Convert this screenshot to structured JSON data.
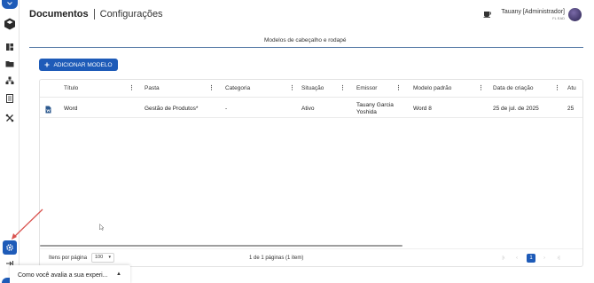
{
  "header": {
    "title": "Documentos",
    "subtitle": "Configurações"
  },
  "user": {
    "name": "Tauany [Administrador]",
    "org": "FL EAD"
  },
  "tab": {
    "label": "Modelos de cabeçalho e rodapé"
  },
  "toolbar": {
    "add_label": "ADICIONAR MODELO"
  },
  "table": {
    "columns": [
      "Título",
      "Pasta",
      "Categoria",
      "Situação",
      "Emissor",
      "Modelo padrão",
      "Data de criação",
      "Atu"
    ],
    "rows": [
      {
        "titulo": "Word",
        "pasta": "Gestão de Produtos*",
        "categoria": "-",
        "situacao": "Ativo",
        "emissor_line1": "Tauany Garcia",
        "emissor_line2": "Yoshida",
        "modelo_padrao": "Word 8",
        "data_criacao": "25 de jul. de 2025",
        "atualizacao": "25"
      }
    ]
  },
  "footer": {
    "per_page_label": "Itens por página",
    "per_page_value": "100",
    "page_info": "1 de 1 páginas (1 item)",
    "current_page": "1"
  },
  "feedback": {
    "text": "Como você avalia a sua experi..."
  },
  "icons": {
    "coffee": "coffee-icon",
    "add": "plus-icon",
    "doc": "word-document-icon",
    "gear": "gear-icon"
  },
  "colors": {
    "primary": "#1e5bb8",
    "annotation_arrow": "#d9534f"
  }
}
